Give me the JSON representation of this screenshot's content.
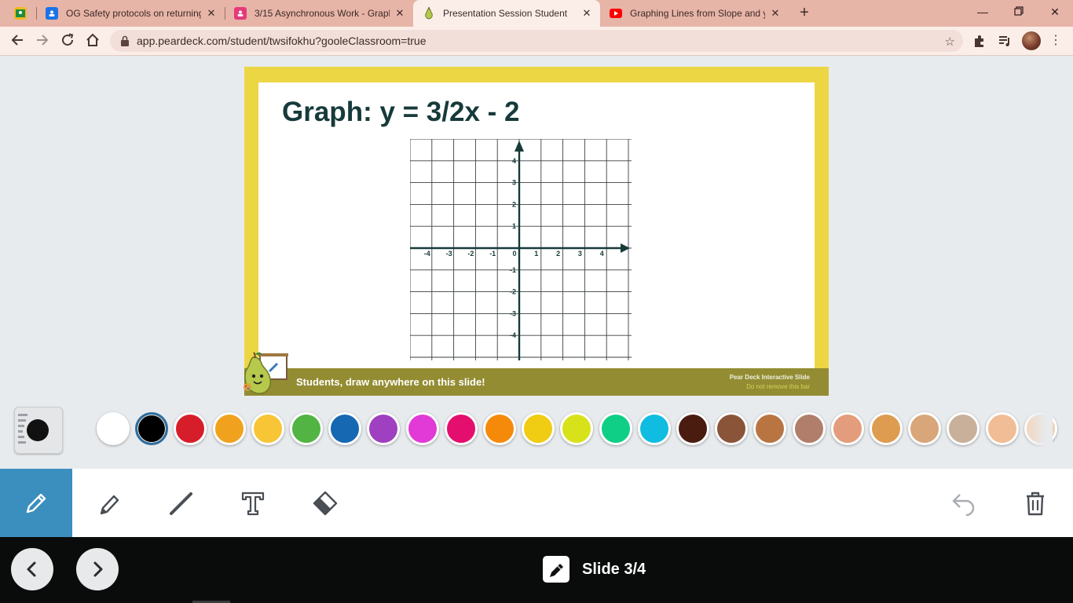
{
  "browser": {
    "tabs": [
      {
        "label": "",
        "icon": "google-classroom-icon",
        "color": "#f2b824"
      },
      {
        "label": "OG Safety protocols on returning",
        "icon": "google-doc-icon",
        "color": "#1a73e8"
      },
      {
        "label": "3/15 Asynchronous Work - Graph",
        "icon": "slides-icon",
        "color": "#e6397a"
      },
      {
        "label": "Presentation Session Student",
        "icon": "pear-icon",
        "color": "#9bb53a"
      },
      {
        "label": "Graphing Lines from Slope and y",
        "icon": "youtube-icon",
        "color": "#ff0000"
      }
    ],
    "url": "app.peardeck.com/student/twsifokhu?gooleClassroom=true"
  },
  "slide": {
    "title": "Graph: y = 3/2x - 2",
    "footer_text": "Students, draw anywhere on this slide!",
    "brand_line1": "Pear Deck Interactive Slide",
    "brand_line2": "Do not remove this bar",
    "graph": {
      "x_ticks": [
        "-4",
        "-3",
        "-2",
        "-1",
        "0",
        "1",
        "2",
        "3",
        "4"
      ],
      "y_ticks": [
        "4",
        "3",
        "2",
        "1",
        "-1",
        "-2",
        "-3",
        "-4"
      ],
      "range": [
        -5,
        5
      ]
    },
    "colors": {
      "frame": "#ecd644",
      "bar": "#938c32",
      "title": "#173a3a"
    }
  },
  "palette": [
    "#ffffff",
    "#000000",
    "#d61e2a",
    "#f0a21e",
    "#f7c535",
    "#52b443",
    "#1668b2",
    "#9e40c0",
    "#e23ad6",
    "#e40e6e",
    "#f58a0a",
    "#f0cc12",
    "#d8e21a",
    "#0fcf86",
    "#10bde0",
    "#4a1c10",
    "#8a5438",
    "#b87542",
    "#b07e6a",
    "#e39c7c",
    "#dd9c50",
    "#d8a678",
    "#c8b09a",
    "#f1bd96",
    "#f3d0b0"
  ],
  "selected_color": "#000000",
  "tools": [
    "pencil",
    "marker",
    "line",
    "text",
    "eraser"
  ],
  "active_tool": "pencil",
  "nav": {
    "slide_label": "Slide 3/4"
  }
}
